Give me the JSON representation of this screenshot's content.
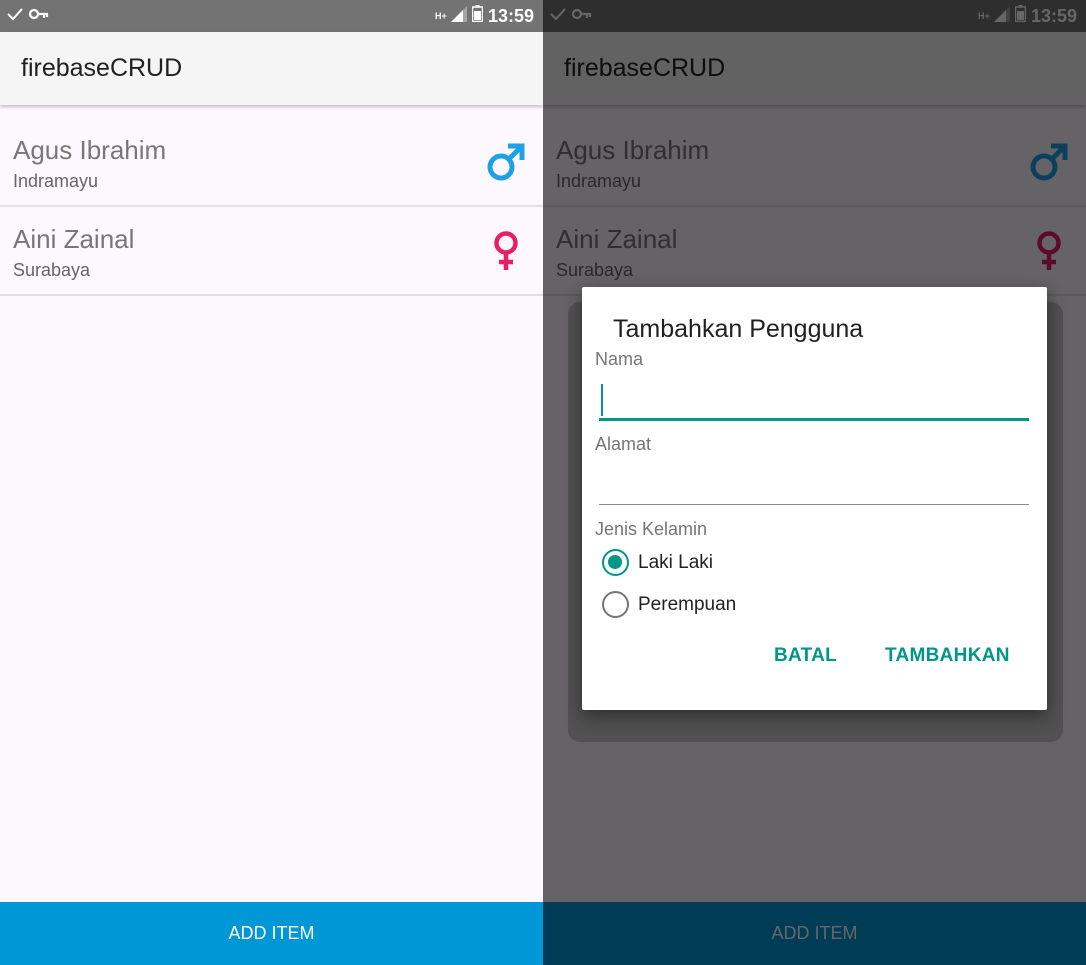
{
  "status_bar": {
    "time": "13:59",
    "network_type": "H+",
    "left_icons": [
      "check-icon",
      "key-icon"
    ],
    "right_icons": [
      "network-arrows-icon",
      "signal-icon",
      "battery-icon"
    ]
  },
  "app": {
    "title": "firebaseCRUD",
    "primary_color": "#0097d6",
    "accent_color": "#009688"
  },
  "users": [
    {
      "name": "Agus Ibrahim",
      "city": "Indramayu",
      "gender": "male",
      "icon": "male-icon",
      "icon_color": "#1da1e6"
    },
    {
      "name": "Aini Zainal",
      "city": "Surabaya",
      "gender": "female",
      "icon": "female-icon",
      "icon_color": "#e91e63"
    }
  ],
  "bottom_button": {
    "label": "ADD ITEM"
  },
  "dialog": {
    "title": "Tambahkan Pengguna",
    "name_label": "Nama",
    "name_value": "",
    "address_label": "Alamat",
    "address_value": "",
    "gender_label": "Jenis Kelamin",
    "options": [
      {
        "label": "Laki Laki",
        "checked": true
      },
      {
        "label": "Perempuan",
        "checked": false
      }
    ],
    "cancel_label": "BATAL",
    "submit_label": "TAMBAHKAN"
  }
}
